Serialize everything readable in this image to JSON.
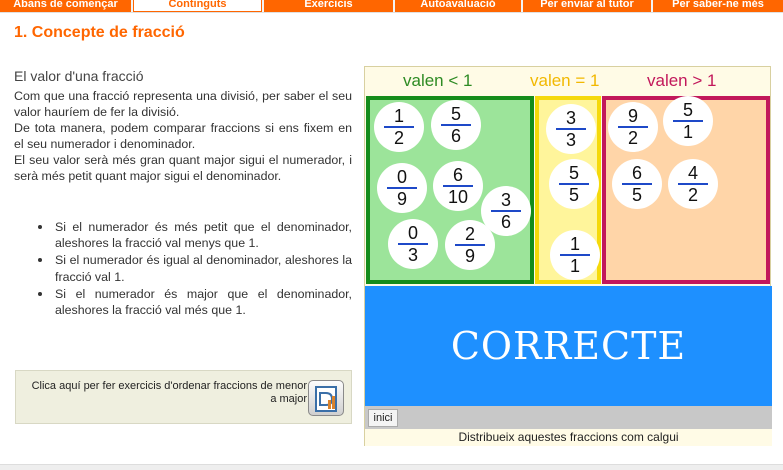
{
  "nav": {
    "tabs": [
      {
        "label": "Abans de començar"
      },
      {
        "label": "Continguts"
      },
      {
        "label": "Exercicis"
      },
      {
        "label": "Autoavaluació"
      },
      {
        "label": "Per enviar al tutor"
      },
      {
        "label": "Per saber-ne més"
      }
    ],
    "active_index": 1
  },
  "page": {
    "title": "1. Concepte de fracció",
    "subtitle": "El valor d'una fracció",
    "intro": [
      "Com que una fracció representa una divisió, per saber el seu valor hauríem de fer la divisió.",
      "De tota manera, podem comparar fraccions si ens fixem en el seu numerador i denominador.",
      "El seu valor serà més gran quant major sigui el numerador, i serà més petit quant major sigui el denominador."
    ],
    "bullets": [
      "Si el numerador és més petit que el denominador, aleshores la fracció val menys que 1.",
      "Si el numerador és igual al denominador, aleshores la fracció val 1.",
      "Si el numerador és major que el denominador, aleshores la fracció val més que 1."
    ]
  },
  "exercise": {
    "text": "Clica aquí per fer exercicis d'ordenar fraccions de menor a major",
    "icon": "ordering-exercise-icon"
  },
  "game": {
    "headers": {
      "less": "valen < 1",
      "equal": "valen = 1",
      "greater": "valen > 1"
    },
    "colors": {
      "less": "#158c1b",
      "equal": "#f5d90a",
      "greater": "#c2185b",
      "result": "#1e90ff"
    },
    "zones": {
      "less": [
        {
          "num": "1",
          "den": "2"
        },
        {
          "num": "5",
          "den": "6"
        },
        {
          "num": "0",
          "den": "9"
        },
        {
          "num": "6",
          "den": "10"
        },
        {
          "num": "3",
          "den": "6"
        },
        {
          "num": "0",
          "den": "3"
        },
        {
          "num": "2",
          "den": "9"
        }
      ],
      "equal": [
        {
          "num": "3",
          "den": "3"
        },
        {
          "num": "5",
          "den": "5"
        },
        {
          "num": "1",
          "den": "1"
        }
      ],
      "greater": [
        {
          "num": "9",
          "den": "2"
        },
        {
          "num": "5",
          "den": "1"
        },
        {
          "num": "6",
          "den": "5"
        },
        {
          "num": "4",
          "den": "2"
        }
      ]
    },
    "result": "CORRECTE",
    "reset_label": "inici",
    "instruction": "Distribueix aquestes fraccions com calgui"
  }
}
